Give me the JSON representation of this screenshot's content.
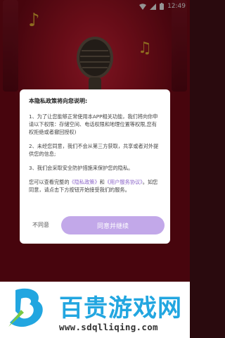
{
  "status_bar": {
    "time": "12:49",
    "icons": [
      "wifi-icon",
      "signal-icon",
      "battery-icon"
    ]
  },
  "colors": {
    "background_red": "#b01628",
    "accent_purple": "#c2a8e9",
    "link_purple": "#8a63c8",
    "watermark_blue": "#22a6e0",
    "note_yellow": "#ffce3a"
  },
  "privacy_dialog": {
    "title": "本隐私政策将向您说明:",
    "items": [
      "1、为了让您能够正常使用本APP相关功能，我们将向你申请以下权限：存储空间、电话权限和地理位置等权限,您有权拒绝或者撤回授权)",
      "2、未经您同意，我们不会从第三方获取，共享或者对外提供您的信息;",
      "3、我们会采取安全防护措施来保护您的隐私。"
    ],
    "footer": {
      "prefix": "您可以查看完整的",
      "link_privacy": "《隐私政策》",
      "conjunction": "和",
      "link_terms": "《用户服务协议》",
      "suffix": "。如您同意，请点击下方按钮开始接受我们的服务。"
    },
    "decline_label": "不同意",
    "agree_label": "同意并继续"
  },
  "watermark": {
    "name": "百贵游戏网",
    "url": "www.sdqlliqing.com"
  }
}
